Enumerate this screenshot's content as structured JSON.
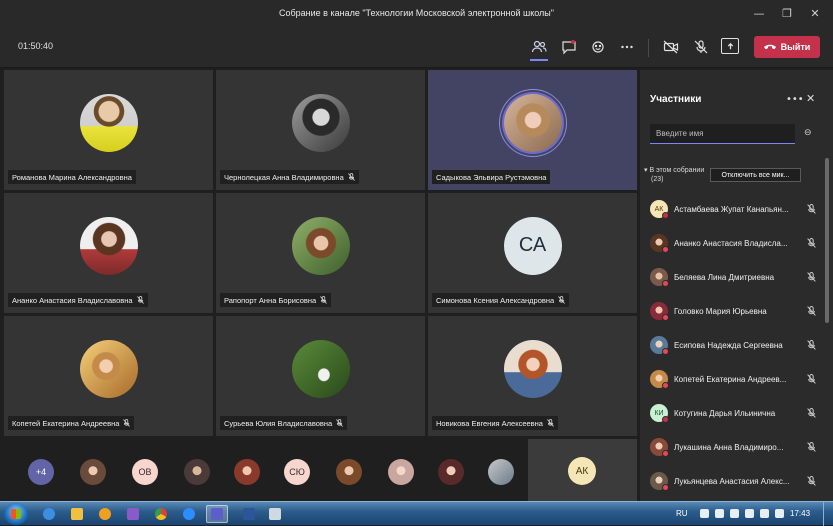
{
  "window": {
    "title": "Собрание в канале \"Технологии Московской электронной школы\""
  },
  "toolbar": {
    "timer": "01:50:40",
    "leave_label": "Выйти",
    "icons": [
      "participants-icon",
      "chat-icon",
      "reactions-icon",
      "more-icon",
      "camera-off-icon",
      "mic-off-icon",
      "share-icon"
    ]
  },
  "tiles": [
    {
      "name": "Романова Марина Александровна",
      "muted": false,
      "avatar": "photo"
    },
    {
      "name": "Чернолецкая Анна Владимировна",
      "muted": true,
      "avatar": "photo"
    },
    {
      "name": "Садыкова Эльвира Рустэмовна",
      "muted": false,
      "avatar": "photo",
      "speaking": true
    },
    {
      "name": "Ананко Анастасия Владиславовна",
      "muted": true,
      "avatar": "photo"
    },
    {
      "name": "Рапопорт Анна Борисовна",
      "muted": true,
      "avatar": "photo"
    },
    {
      "name": "Симонова Ксения Александровна",
      "muted": true,
      "avatar": "initials",
      "initials": "СА"
    },
    {
      "name": "Копетей Екатерина Андреевна",
      "muted": true,
      "avatar": "photo"
    },
    {
      "name": "Сурьева Юлия Владиславовна",
      "muted": true,
      "avatar": "photo"
    },
    {
      "name": "Новикова Евгения Алексеевна",
      "muted": true,
      "avatar": "photo"
    }
  ],
  "strip": {
    "overflow": "+4",
    "initials_1": "ОВ",
    "initials_2": "СЮ",
    "self_initials": "АК"
  },
  "panel": {
    "title": "Участники",
    "search_placeholder": "Введите имя",
    "section_label": "В этом собрании",
    "section_count": "(23)",
    "mute_all_label": "Отключить все мик...",
    "participants": [
      {
        "name": "Астамбаева Жупат Канапьян...",
        "initials": "АК"
      },
      {
        "name": "Ананко Анастасия Владисла...",
        "initials": ""
      },
      {
        "name": "Беляева Лина Дмитриевна",
        "initials": ""
      },
      {
        "name": "Головко Мария Юрьевна",
        "initials": ""
      },
      {
        "name": "Есипова Надежда Сергеевна",
        "initials": ""
      },
      {
        "name": "Копетей Екатерина Андреев...",
        "initials": ""
      },
      {
        "name": "Котугина Дарья Ильинична",
        "initials": "КИ"
      },
      {
        "name": "Лукашина Анна Владимиро...",
        "initials": ""
      },
      {
        "name": "Лукьянцева Анастасия Алекс...",
        "initials": ""
      }
    ]
  },
  "taskbar": {
    "lang": "RU",
    "time": "17:43"
  }
}
